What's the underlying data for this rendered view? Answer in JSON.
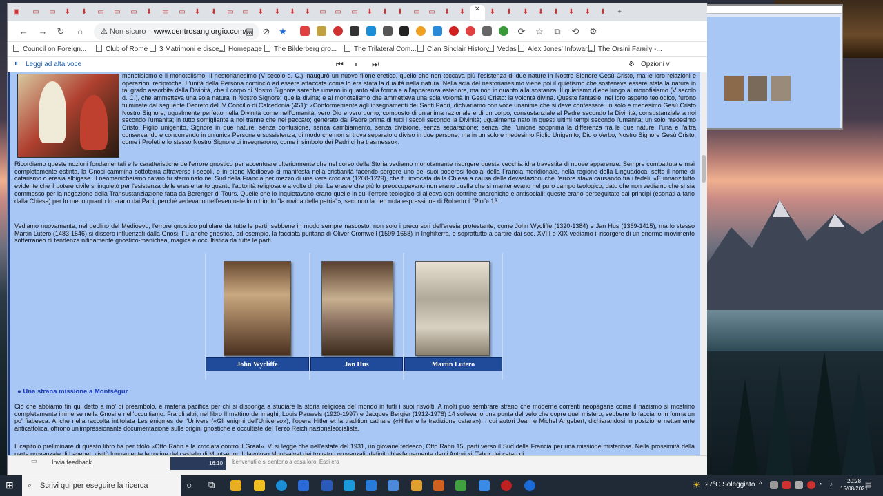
{
  "browser": {
    "address": {
      "security": "Non sicuro",
      "url": "www.centrosangiorgio.com/..."
    },
    "bookmarks": [
      "Council on Foreign...",
      "Club of Rome",
      "3 Matrimoni e disce...",
      "Homepage",
      "The Bilderberg gro...",
      "The Trilateral Com...",
      "Cian Sinclair History",
      "Vedas",
      "Alex Jones' Infowar...",
      "The Orsini Family -..."
    ],
    "reader": {
      "label": "Leggi ad alta voce",
      "options": "Opzioni v"
    }
  },
  "article": {
    "para1": "monofisismo e il monotelismo. Il nestorianesimo (V secolo d. C.) inaugurò un nuovo filone eretico, quello che non toccava più l'esistenza di due nature in Nostro Signore Gesù Cristo, ma le loro relazioni e operazioni reciproche. L'unità della Persona cominciò ad essere attaccata come lo era stata la dualità nella natura. Nella scia del nestorianesimo viene poi il quietismo che sosteneva essere stata la natura in tal grado assorbita dalla Divinità, che il corpo di Nostro Signore sarebbe umano in quanto alla forma e all'apparenza esteriore, ma non in quanto alla sostanza. Il quietismo diede luogo al monofisismo (V secolo d. C.), che ammetteva una sola natura in Nostro Signore: quella divina; e al monotelismo che ammetteva una sola volontà in Gesù Cristo: la volontà divina. Queste fantasie, nel loro aspetto teologico, furono fulminate dal seguente Decreto del IV Concilio di Calcedonia (451): «Conformemente agli insegnamenti dei Santi Padri, dichiariamo con voce unanime che si deve confessare un solo e medesimo Gesù Cristo Nostro Signore; ugualmente perfetto nella Divinità come nell'Umanità; vero Dio e vero uomo, composto di un'anima razionale e di un corpo; consustanziale al Padre secondo la Divinità, consustanziale a noi secondo l'umanità; in tutto somigliante a noi tranne che nel peccato; generato dal Padre prima di tutti i secoli secondo la Divinità; ugualmente nato in questi ultimi tempi secondo l'umanità; un solo medesimo Cristo, Figlio unigenito, Signore in due nature, senza confusione, senza cambiamento, senza divisione, senza separazione; senza che l'unione sopprima la differenza fra le due nature, l'una e l'altra conservando e concorrendo in un'unica Persona e sussistenza; di modo che non si trova separato o diviso in due persone, ma in un solo e medesimo Figlio Unigenito, Dio o Verbo, Nostro Signore Gesù Cristo, come i Profeti e lo stesso Nostro Signore ci insegnarono, come il simbolo dei Padri ci ha trasmesso».",
    "para2": "Ricordiamo queste nozioni fondamentali e le caratteristiche dell'errore gnostico per accentuare ulteriormente che nel corso della Storia vediamo monotamente risorgere questa vecchia idra travestita di nuove apparenze. Sempre combattuta e mai completamente estinta, la Gnosi cammina sottoterra attraverso i secoli, e in pieno Medioevo si manifesta nella cristianità facendo sorgere uno dei suoi poderosi focolai della Francia meridionale, nella regione della Linguadoca, sotto il nome di catarismo o eresia albigese. Il neomanicheismo cataro fu sterminato nel Sud della Francia per mezzo di una vera crociata (1208-1229), che fu invocata dalla Chiesa a causa delle devastazioni che l'errore stava causando fra i fedeli. «È innanzitutto evidente che il potere civile si inquietò per l'esistenza delle eresie tanto quanto l'autorità religiosa e a volte di più. Le eresie che più lo preoccupavano non erano quelle che si mantenevano nel puro campo teologico, dato che non vediamo che si sia commosso per la negazione della Transustanziazione fatta da Berenger di Tours. Quelle che lo inquietavano erano quelle in cui l'errore teologico si alleava con dottrine anarchiche e antisociali; queste erano perseguitate dai principi (esortati a farlo dalla Chiesa) per lo meno quanto lo erano dai Papi, perché vedevano nell'eventuale loro trionfo \"la rovina della patria\"», secondo la ben nota espressione di Roberto il \"Pio\"» 13.",
    "para3": "Vediamo nuovamente, nel declino del Medioevo, l'errore gnostico pullulare da tutte le parti, sebbene in modo sempre nascosto; non solo i precursori dell'eresia protestante, come John Wycliffe (1320-1384) e Jan Hus (1369-1415), ma lo stesso Martin Lutero (1483-1546) si dissero influenzati dalla Gnosi. Fu anche gnostica, ad esempio, la facciata puritana di Oliver Cromwell (1599-1658) in Inghilterra, e soprattutto a partire dai sec. XVIII e XIX vediamo il risorgere di un enorme movimento sotterraneo di tendenza nitidamente gnostico-manichea, magica e occultistica da tutte le parti.",
    "portraits": [
      "John Wycliffe",
      "Jan Hus",
      "Martin Lutero"
    ],
    "section_title": "Una strana missione a Montségur",
    "para4": "Ciò che abbiamo fin qui detto a mo' di preambolo, è materia pacifica per chi si disponga a studiare la storia religiosa del mondo in tutti i suoi risvolti. A molti può sembrare strano che moderne correnti neopagane come il nazismo si mostrino completamente immerse nella Gnosi e nell'occultismo. Fra gli altri, nel libro Il mattino dei maghi, Louis Pauwels (1920-1997) e Jacques Bergier (1912-1978) 14 sollevano una punta del velo che copre quel mistero, sebbene lo facciano in forma un po' fiabesca. Anche nella raccolta intitolata Les énigmes de l'Univers («Gli enigmi dell'Universo»), l'opera Hitler et la tradition cathare («Hitler e la tradizione catara»), i cui autori Jean e Michel Angebert, dichiarandosi in posizione nettamente anticattolica, offrono un'impressionante documentazione sulle origini gnostiche e occultiste del Terzo Reich nazionalsocialista.",
    "para5": "Il capitolo preliminare di questo libro ha per titolo «Otto Rahn e la crociata contro il Graal». Vi si legge che nell'estate del 1931, un giovane tedesco, Otto Rahn 15, parti verso il Sud della Francia per una missione misteriosa. Nella prossimità della parte provenzale di Lavenet, visitò lungamente le rovine del castello di Montségur. Il favoloso Montsalvat dei trovatori provenzali, definito blasfemamente dagli Autori «il Tabor dei catari di"
  },
  "feedback": {
    "label": "Invia feedback",
    "time": "16:10",
    "ticker": "benvenuti e si sentono a casa loro. Essi era"
  },
  "taskbar": {
    "search": "Scrivi qui per eseguire la ricerca",
    "weather": "27°C Soleggiato",
    "time": "20:28",
    "date": "15/08/2021"
  }
}
